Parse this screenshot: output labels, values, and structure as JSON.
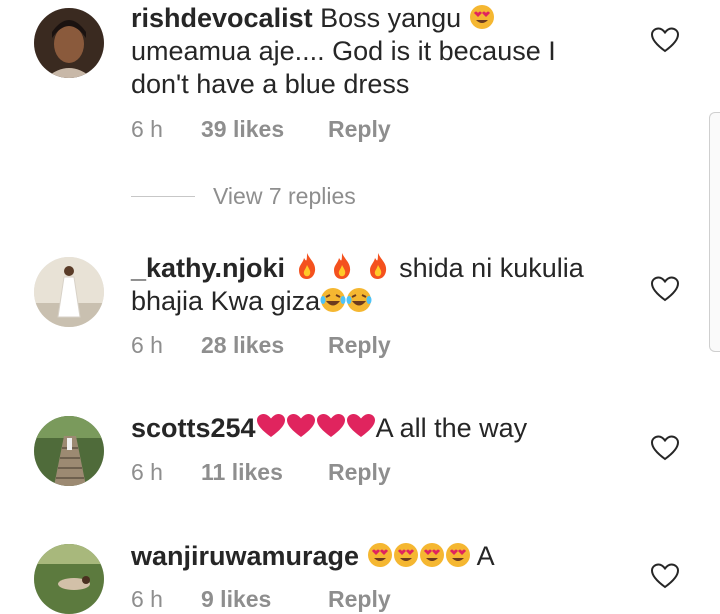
{
  "comments": [
    {
      "username": "rishdevocalist",
      "text_before": "Boss yangu",
      "text_after": "umeamua aje.... God is it because I don't have a blue dress",
      "time": "6 h",
      "likes": "39 likes",
      "reply": "Reply",
      "avatar": "avatar-woman-portrait"
    },
    {
      "username": "_kathy.njoki",
      "text_before": "",
      "text_after": "shida ni kukulia bhajia Kwa giza",
      "time": "6 h",
      "likes": "28 likes",
      "reply": "Reply",
      "avatar": "avatar-woman-white-dress"
    },
    {
      "username": "scotts254",
      "text_after": "A all the way",
      "time": "6 h",
      "likes": "11 likes",
      "reply": "Reply",
      "avatar": "avatar-stairs-garden"
    },
    {
      "username": "wanjiruwamurage",
      "text_after": "A",
      "time": "6 h",
      "likes": "9 likes",
      "reply": "Reply",
      "avatar": "avatar-lawn-outdoor"
    }
  ],
  "view_replies": "View 7 replies",
  "colors": {
    "text": "#262626",
    "meta": "#8e8e8e",
    "heart_red": "#e0245e",
    "fire": "#f4511e"
  }
}
